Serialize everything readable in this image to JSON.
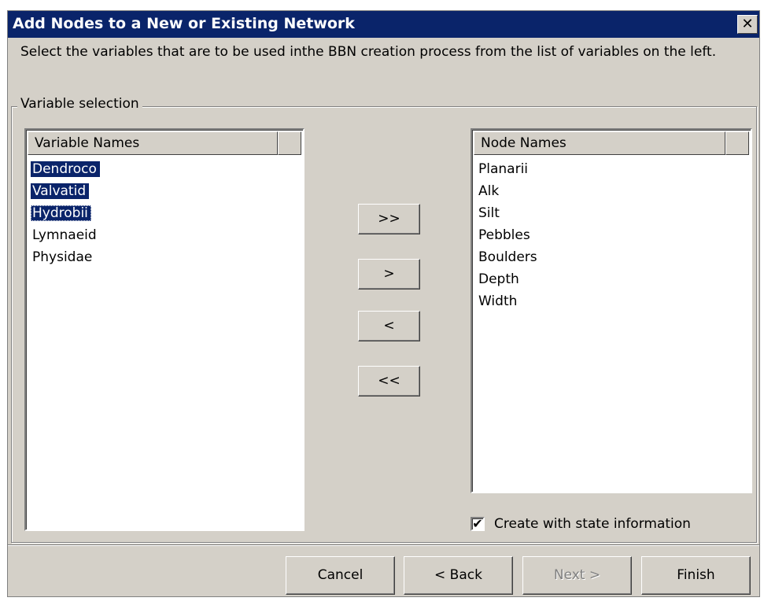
{
  "window": {
    "title": "Add Nodes to a New or Existing Network",
    "close_glyph": "✕"
  },
  "instruction": "Select the variables that are to be used inthe BBN creation process from the list of variables on the left.",
  "variable_selection": {
    "group_label": "Variable selection",
    "left_list": {
      "header": "Variable Names",
      "items": [
        {
          "label": "Dendroco",
          "selected": true
        },
        {
          "label": "Valvatid",
          "selected": true
        },
        {
          "label": "Hydrobii",
          "selected": true,
          "focused": true
        },
        {
          "label": "Lymnaeid",
          "selected": false
        },
        {
          "label": "Physidae",
          "selected": false
        }
      ]
    },
    "right_list": {
      "header": "Node Names",
      "items": [
        "Planarii",
        "Alk",
        "Silt",
        "Pebbles",
        "Boulders",
        "Depth",
        "Width"
      ]
    },
    "move_buttons": {
      "add_all": ">>",
      "add": ">",
      "remove": "<",
      "remove_all": "<<"
    },
    "checkbox": {
      "label": "Create with state information",
      "checked": true,
      "check_glyph": "✔"
    }
  },
  "buttons": {
    "cancel": "Cancel",
    "back": "< Back",
    "next": "Next >",
    "finish": "Finish"
  },
  "colors": {
    "titlebar": "#0a246a",
    "selection": "#0a246a",
    "dialog_bg": "#d4d0c8"
  }
}
